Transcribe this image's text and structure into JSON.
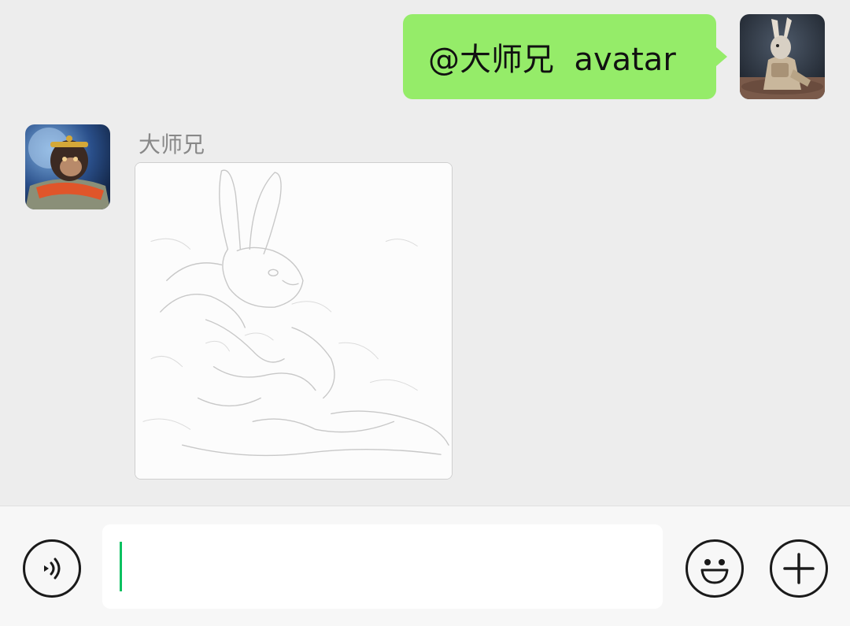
{
  "conversation": {
    "outgoing_message": {
      "text": "@大师兄  avatar"
    },
    "incoming_message": {
      "sender_name": "大师兄",
      "content_type": "image"
    }
  },
  "input_bar": {
    "input_value": "",
    "icons": {
      "voice": "voice-icon",
      "emoji": "emoji-icon",
      "more": "plus-icon"
    }
  },
  "colors": {
    "chat_background": "#ededed",
    "outgoing_bubble": "#95ec69",
    "caret": "#07c160",
    "input_bar_background": "#f7f7f7"
  }
}
